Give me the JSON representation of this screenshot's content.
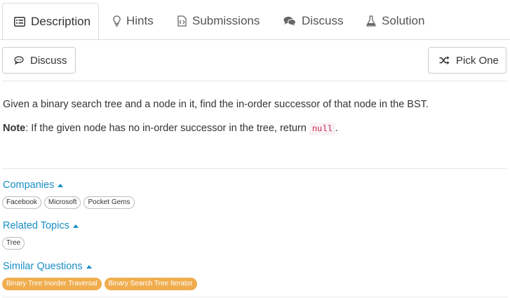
{
  "tabs": [
    {
      "label": "Description",
      "icon": "list-icon",
      "active": true
    },
    {
      "label": "Hints",
      "icon": "lightbulb-icon"
    },
    {
      "label": "Submissions",
      "icon": "code-file-icon"
    },
    {
      "label": "Discuss",
      "icon": "comments-icon"
    },
    {
      "label": "Solution",
      "icon": "flask-icon"
    }
  ],
  "toolbar": {
    "discuss_label": "Discuss",
    "pick_one_label": "Pick One"
  },
  "problem": {
    "text": "Given a binary search tree and a node in it, find the in-order successor of that node in the BST.",
    "note_label": "Note",
    "note_text": ": If the given node has no in-order successor in the tree, return ",
    "note_code": "null",
    "note_end": "."
  },
  "companies": {
    "title": "Companies",
    "items": [
      "Facebook",
      "Microsoft",
      "Pocket Gems"
    ]
  },
  "related_topics": {
    "title": "Related Topics",
    "items": [
      "Tree"
    ]
  },
  "similar_questions": {
    "title": "Similar Questions",
    "items": [
      "Binary Tree Inorder Traversal",
      "Binary Search Tree Iterator"
    ]
  },
  "colors": {
    "link": "#1a8dc7",
    "orange_chip": "#f0ad4e",
    "code": "#c7254e"
  }
}
